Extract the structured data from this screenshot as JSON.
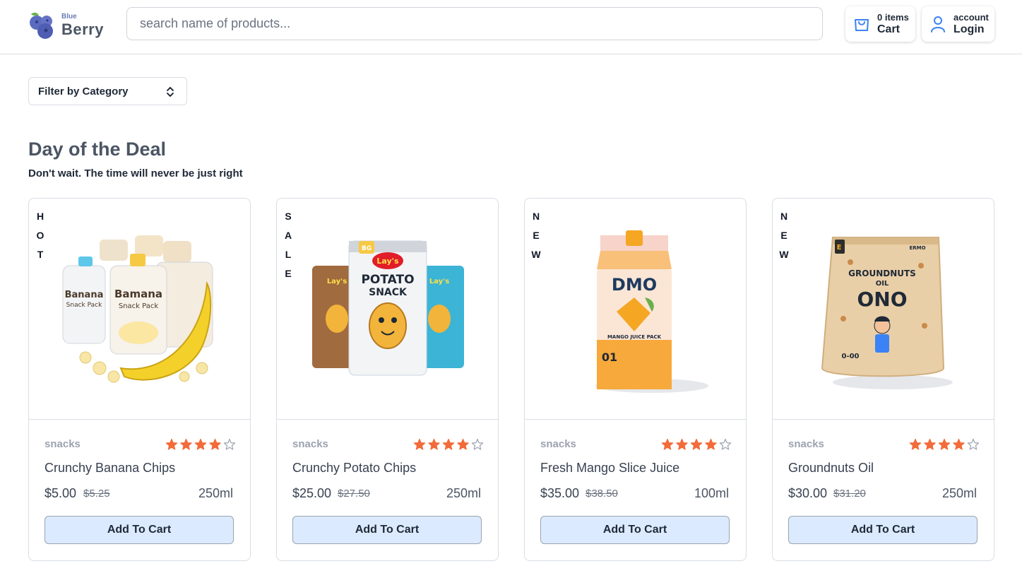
{
  "header": {
    "brand_small": "Blue",
    "brand_big": "Berry",
    "search_placeholder": "search name of products...",
    "cart": {
      "count_label": "0 items",
      "label": "Cart",
      "icon": "shopping-bag-icon"
    },
    "account": {
      "top_label": "account",
      "label": "Login",
      "icon": "user-icon"
    }
  },
  "filter": {
    "label": "Filter by Category"
  },
  "section": {
    "title": "Day of the Deal",
    "subtitle": "Don't wait. The time will never be just right"
  },
  "products": [
    {
      "tag": "HOT",
      "category": "snacks",
      "rating": 4,
      "max_rating": 5,
      "name": "Crunchy Banana Chips",
      "price": "$5.00",
      "old_price": "$5.25",
      "size": "250ml",
      "button": "Add To Cart"
    },
    {
      "tag": "SALE",
      "category": "snacks",
      "rating": 4,
      "max_rating": 5,
      "name": "Crunchy Potato Chips",
      "price": "$25.00",
      "old_price": "$27.50",
      "size": "250ml",
      "button": "Add To Cart"
    },
    {
      "tag": "NEW",
      "category": "snacks",
      "rating": 4,
      "max_rating": 5,
      "name": "Fresh Mango Slice Juice",
      "price": "$35.00",
      "old_price": "$38.50",
      "size": "100ml",
      "button": "Add To Cart"
    },
    {
      "tag": "NEW",
      "category": "snacks",
      "rating": 4,
      "max_rating": 5,
      "name": "Groundnuts Oil",
      "price": "$30.00",
      "old_price": "$31.20",
      "size": "250ml",
      "button": "Add To Cart"
    }
  ],
  "product_images": [
    {
      "lettering": [
        "Banana Snack Pack",
        "Bamana Snack Pack"
      ]
    },
    {
      "lettering": [
        "Lay's",
        "POTATO SNACK",
        "BG"
      ]
    },
    {
      "lettering": [
        "DMO",
        "MANGO JUICE PACK",
        "01"
      ]
    },
    {
      "lettering": [
        "ERMO",
        "GROUNDNUTS OIL",
        "ONO",
        "0-00"
      ]
    }
  ],
  "colors": {
    "star": "#f26b3a",
    "star_empty": "#9ca3af",
    "button_bg": "#dbeafe",
    "accent": "#3b82f6"
  }
}
